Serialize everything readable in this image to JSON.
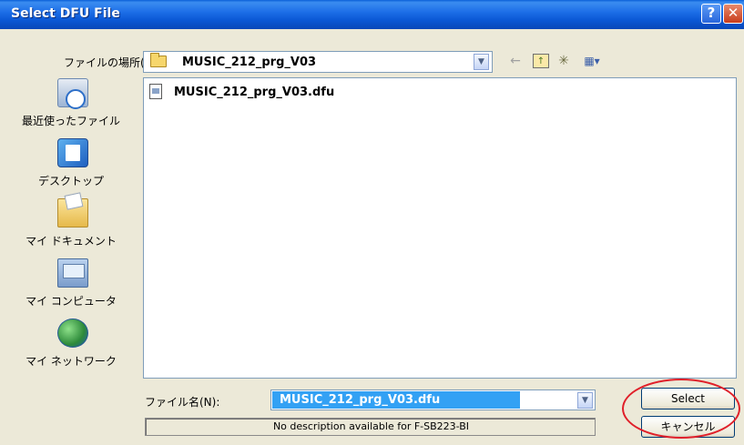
{
  "window": {
    "title": "Select DFU File"
  },
  "titlebar_buttons": {
    "help": "?",
    "close": "✕"
  },
  "look_in": {
    "label": "ファイルの場所(I):",
    "value": "MUSIC_212_prg_V03"
  },
  "toolbar": {
    "back_icon": "←",
    "up_icon": "↑",
    "new_folder_icon": "✳",
    "view_icon": "▦▾"
  },
  "places": [
    {
      "label": "最近使ったファイル",
      "icon": "recent-files-icon"
    },
    {
      "label": "デスクトップ",
      "icon": "desktop-icon"
    },
    {
      "label": "マイ ドキュメント",
      "icon": "my-documents-icon"
    },
    {
      "label": "マイ コンピュータ",
      "icon": "my-computer-icon"
    },
    {
      "label": "マイ ネットワーク",
      "icon": "my-network-icon"
    }
  ],
  "files": [
    {
      "name": "MUSIC_212_prg_V03.dfu",
      "icon": "dfu-file-icon"
    }
  ],
  "filename": {
    "label": "ファイル名(N):",
    "value": "MUSIC_212_prg_V03.dfu"
  },
  "buttons": {
    "select": "Select",
    "cancel": "キャンセル"
  },
  "description": "No description available for F-SB223-BI",
  "colors": {
    "titlebar": "#0a57d4",
    "selection": "#33a1f4",
    "highlight_ring": "#e0202a"
  }
}
